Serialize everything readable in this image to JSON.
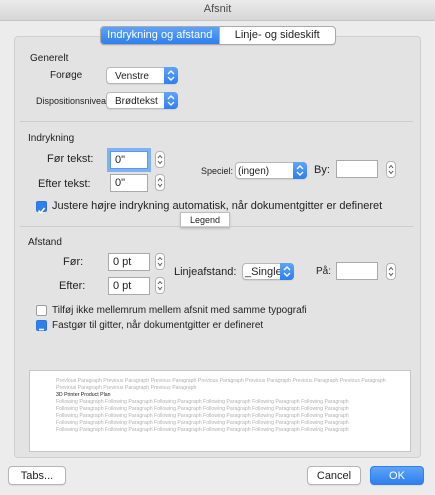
{
  "window": {
    "title": "Afsnit"
  },
  "tabs": [
    {
      "label": "Indrykning og afstand",
      "active": true
    },
    {
      "label": "Linje- og sideskift",
      "active": false
    }
  ],
  "general": {
    "heading": "Generelt",
    "alignment_label": "Forøge",
    "alignment_value": "Venstre",
    "outline_label": "Dispositionsniveau:",
    "outline_value": "Brødtekst"
  },
  "indentation": {
    "heading": "Indrykning",
    "before_label": "Før tekst:",
    "before_value": "0\"",
    "after_label": "Efter tekst:",
    "after_value": "0\"",
    "special_label": "Speciel:",
    "special_value": "(ingen)",
    "by_label": "By:",
    "by_value": "",
    "auto_adjust_label": "Justere højre indrykning automatisk, når dokumentgitter er defineret",
    "auto_adjust_checked": true
  },
  "tooltip": {
    "text": "Legend"
  },
  "spacing": {
    "heading": "Afstand",
    "before_label": "Før:",
    "before_value": "0 pt",
    "after_label": "Efter:",
    "after_value": "0 pt",
    "line_spacing_label": "Linjeafstand:",
    "line_spacing_value": "_Single",
    "at_label": "På:",
    "at_value": "",
    "no_space_label": "Tilføj ikke mellemrum mellem afsnit med samme typografi",
    "no_space_checked": false,
    "snap_grid_label": "Fastgør til gitter, når dokumentgitter er defineret",
    "snap_grid_state": "mixed"
  },
  "preview": {
    "previous_line_1": "Previous Paragraph Previous Paragraph Previous Paragraph Previous Paragraph Previous Paragraph Previous Paragraph Previous Paragraph",
    "previous_line_2": "Previous Paragraph Previous Paragraph Previous Paragraph",
    "current": "3D Printer Product Plan",
    "following_line_1": "Following Paragraph Following Paragraph Following Paragraph Following Paragraph Following Paragraph Following Paragraph",
    "following_line_2": "Following Paragraph Following Paragraph Following Paragraph Following Paragraph Following Paragraph Following Paragraph",
    "following_line_3": "Following Paragraph Following Paragraph Following Paragraph Following Paragraph Following Paragraph Following Paragraph",
    "following_line_4": "Following Paragraph Following Paragraph Following Paragraph Following Paragraph Following Paragraph Following Paragraph",
    "following_line_5": "Following Paragraph Following Paragraph Following Paragraph Following Paragraph Following Paragraph Following Paragraph"
  },
  "buttons": {
    "tabs": "Tabs...",
    "cancel": "Cancel",
    "ok": "OK"
  },
  "colors": {
    "accent": "#2e7ff0",
    "focus_ring": "#7fb2f3"
  }
}
